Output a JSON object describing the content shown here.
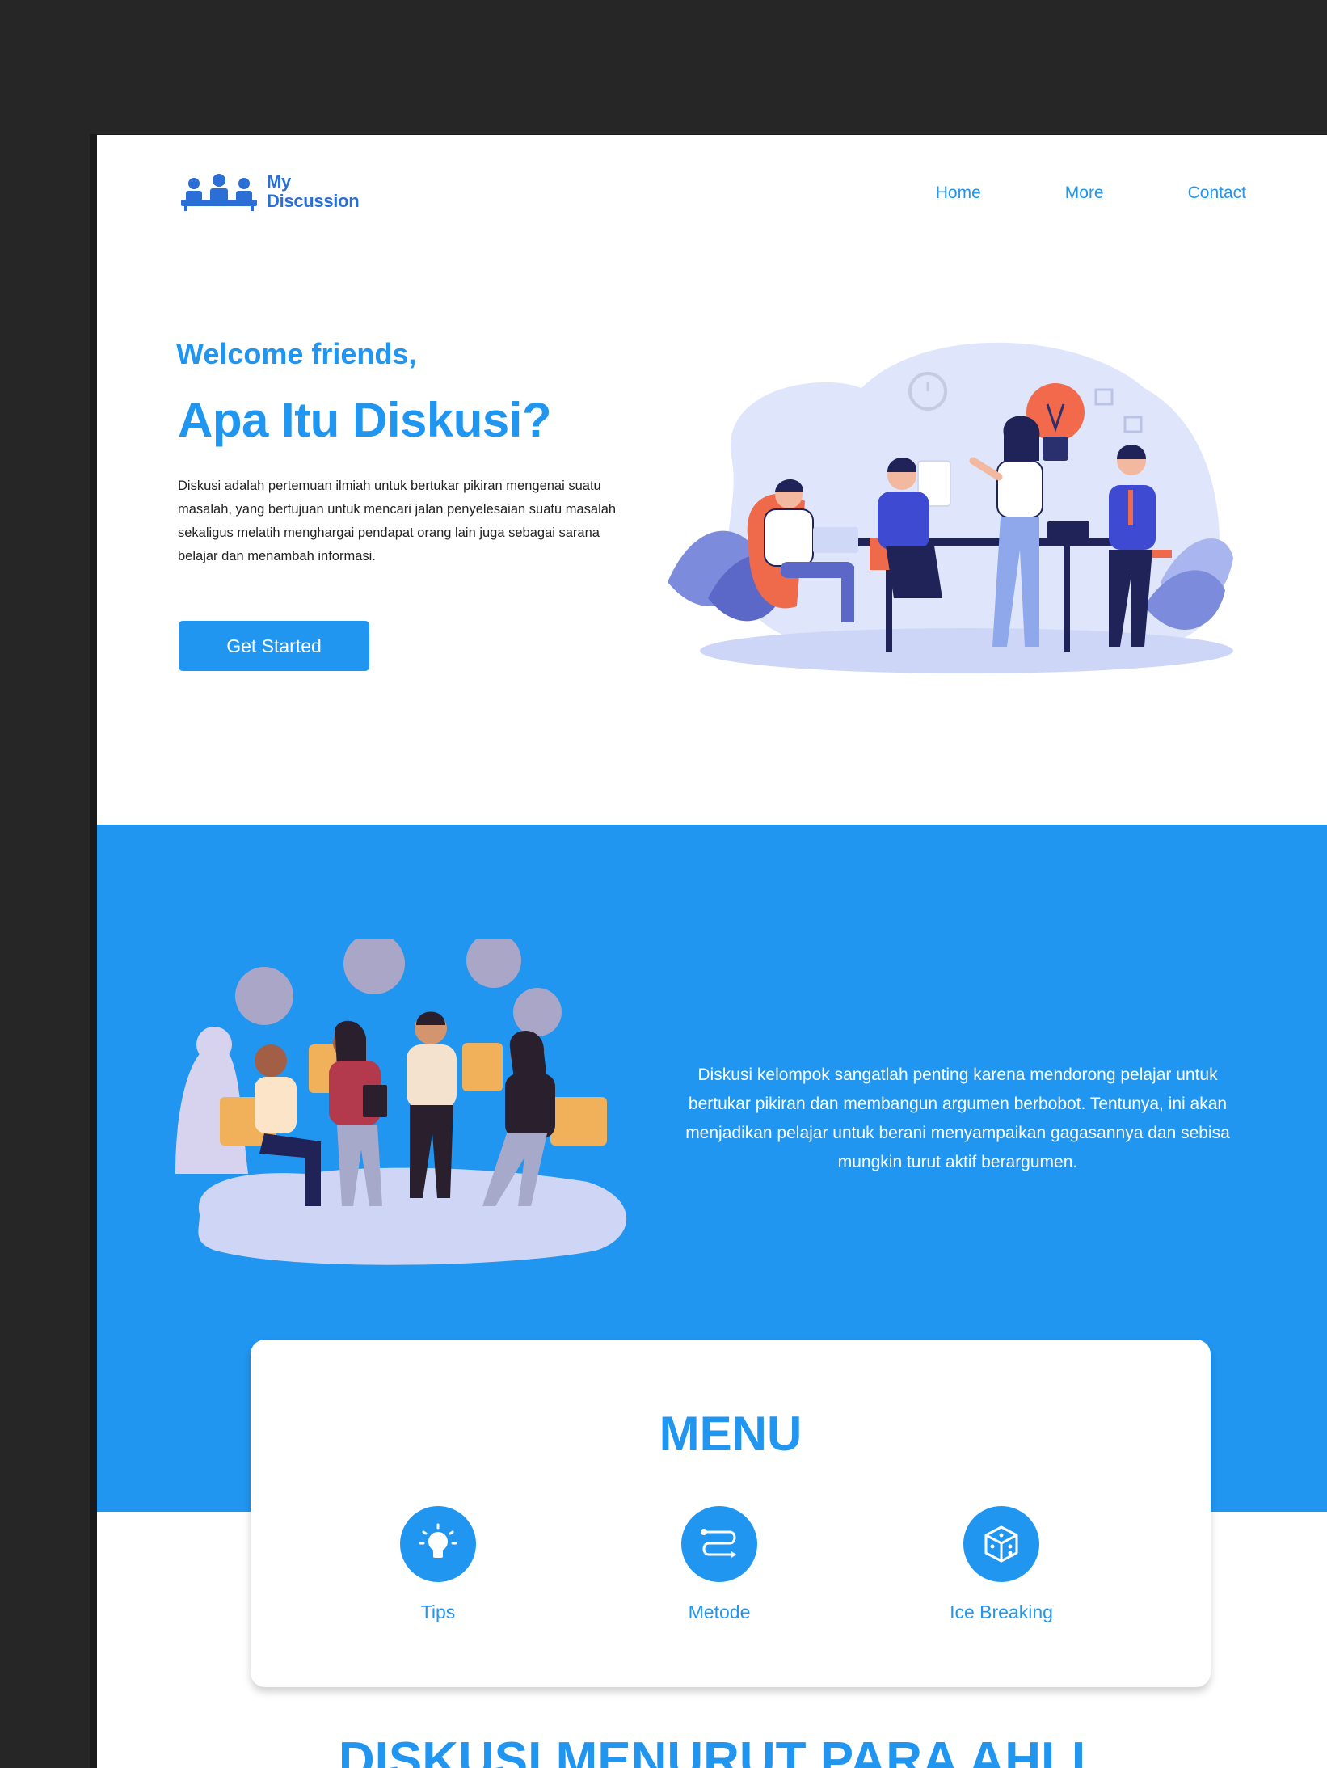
{
  "brand": {
    "name_line1": "My",
    "name_line2": "Discussion"
  },
  "nav": {
    "home": "Home",
    "more": "More",
    "contact": "Contact"
  },
  "hero": {
    "kicker": "Welcome friends,",
    "title": "Apa Itu Diskusi?",
    "description": "Diskusi adalah pertemuan ilmiah untuk bertukar pikiran mengenai suatu masalah, yang bertujuan untuk mencari jalan penyelesaian suatu masalah sekaligus melatih menghargai pendapat orang lain juga sebagai sarana belajar dan menambah informasi.",
    "cta": "Get Started"
  },
  "about": {
    "text": "Diskusi kelompok sangatlah penting karena mendorong pelajar untuk bertukar pikiran dan membangun argumen berbobot. Tentunya, ini akan menjadikan pelajar untuk berani menyampaikan gagasannya dan sebisa mungkin turut aktif berargumen."
  },
  "menu": {
    "title": "MENU",
    "items": [
      {
        "label": "Tips",
        "icon": "lightbulb-icon"
      },
      {
        "label": "Metode",
        "icon": "flow-route-icon"
      },
      {
        "label": "Ice Breaking",
        "icon": "dice-icon"
      }
    ]
  },
  "section2": {
    "title": "DISKUSI MENURUT PARA AHLI"
  },
  "colors": {
    "primary": "#2196f0",
    "canvas_bg": "#262626",
    "page_bg": "#ffffff"
  }
}
